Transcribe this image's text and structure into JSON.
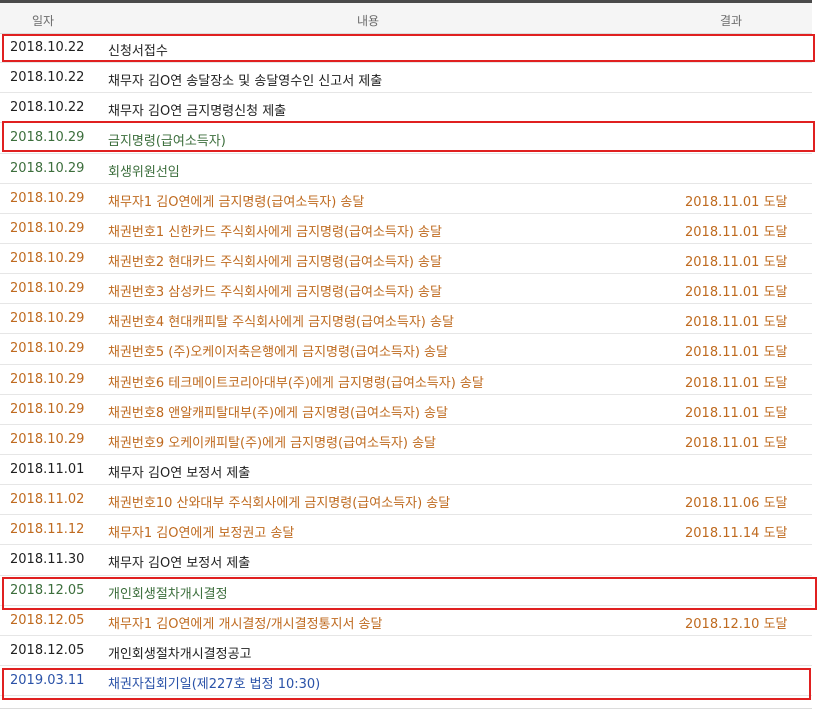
{
  "header": {
    "date": "일자",
    "content": "내용",
    "result": "결과"
  },
  "colors": {
    "black": "#1f1f1f",
    "green": "#3c6e3c",
    "orange": "#bf6a1f",
    "blue": "#2a52a8",
    "highlight": "#e02020"
  },
  "rows": [
    {
      "date": "2018.10.22",
      "content": "신청서접수",
      "result": "",
      "color": "black",
      "highlighted": true
    },
    {
      "date": "2018.10.22",
      "content": "채무자 김O연 송달장소 및 송달영수인 신고서 제출",
      "result": "",
      "color": "black",
      "highlighted": false
    },
    {
      "date": "2018.10.22",
      "content": "채무자 김O연 금지명령신청 제출",
      "result": "",
      "color": "black",
      "highlighted": false
    },
    {
      "date": "2018.10.29",
      "content": "금지명령(급여소득자)",
      "result": "",
      "color": "green",
      "highlighted": true
    },
    {
      "date": "2018.10.29",
      "content": "회생위원선임",
      "result": "",
      "color": "green",
      "highlighted": false
    },
    {
      "date": "2018.10.29",
      "content": "채무자1 김O연에게 금지명령(급여소득자) 송달",
      "result": "2018.11.01 도달",
      "color": "orange",
      "highlighted": false
    },
    {
      "date": "2018.10.29",
      "content": "채권번호1 신한카드 주식회사에게 금지명령(급여소득자) 송달",
      "result": "2018.11.01 도달",
      "color": "orange",
      "highlighted": false
    },
    {
      "date": "2018.10.29",
      "content": "채권번호2 현대카드 주식회사에게 금지명령(급여소득자) 송달",
      "result": "2018.11.01 도달",
      "color": "orange",
      "highlighted": false
    },
    {
      "date": "2018.10.29",
      "content": "채권번호3 삼성카드 주식회사에게 금지명령(급여소득자) 송달",
      "result": "2018.11.01 도달",
      "color": "orange",
      "highlighted": false
    },
    {
      "date": "2018.10.29",
      "content": "채권번호4 현대캐피탈 주식회사에게 금지명령(급여소득자) 송달",
      "result": "2018.11.01 도달",
      "color": "orange",
      "highlighted": false
    },
    {
      "date": "2018.10.29",
      "content": "채권번호5 (주)오케이저축은행에게 금지명령(급여소득자) 송달",
      "result": "2018.11.01 도달",
      "color": "orange",
      "highlighted": false
    },
    {
      "date": "2018.10.29",
      "content": "채권번호6 테크메이트코리아대부(주)에게 금지명령(급여소득자) 송달",
      "result": "2018.11.01 도달",
      "color": "orange",
      "highlighted": false
    },
    {
      "date": "2018.10.29",
      "content": "채권번호8 앤알캐피탈대부(주)에게 금지명령(급여소득자) 송달",
      "result": "2018.11.01 도달",
      "color": "orange",
      "highlighted": false
    },
    {
      "date": "2018.10.29",
      "content": "채권번호9 오케이캐피탈(주)에게 금지명령(급여소득자) 송달",
      "result": "2018.11.01 도달",
      "color": "orange",
      "highlighted": false
    },
    {
      "date": "2018.11.01",
      "content": "채무자 김O연 보정서 제출",
      "result": "",
      "color": "black",
      "highlighted": false
    },
    {
      "date": "2018.11.02",
      "content": "채권번호10 산와대부 주식회사에게 금지명령(급여소득자) 송달",
      "result": "2018.11.06 도달",
      "color": "orange",
      "highlighted": false
    },
    {
      "date": "2018.11.12",
      "content": "채무자1 김O연에게 보정권고 송달",
      "result": "2018.11.14 도달",
      "color": "orange",
      "highlighted": false
    },
    {
      "date": "2018.11.30",
      "content": "채무자 김O연 보정서 제출",
      "result": "",
      "color": "black",
      "highlighted": false
    },
    {
      "date": "2018.12.05",
      "content": "개인회생절차개시결정",
      "result": "",
      "color": "green",
      "highlighted": true
    },
    {
      "date": "2018.12.05",
      "content": "채무자1 김O연에게 개시결정/개시결정통지서 송달",
      "result": "2018.12.10 도달",
      "color": "orange",
      "highlighted": false
    },
    {
      "date": "2018.12.05",
      "content": "개인회생절차개시결정공고",
      "result": "",
      "color": "black",
      "highlighted": false
    },
    {
      "date": "2019.03.11",
      "content": "채권자집회기일(제227호 법정 10:30)",
      "result": "",
      "color": "blue",
      "highlighted": true
    }
  ]
}
